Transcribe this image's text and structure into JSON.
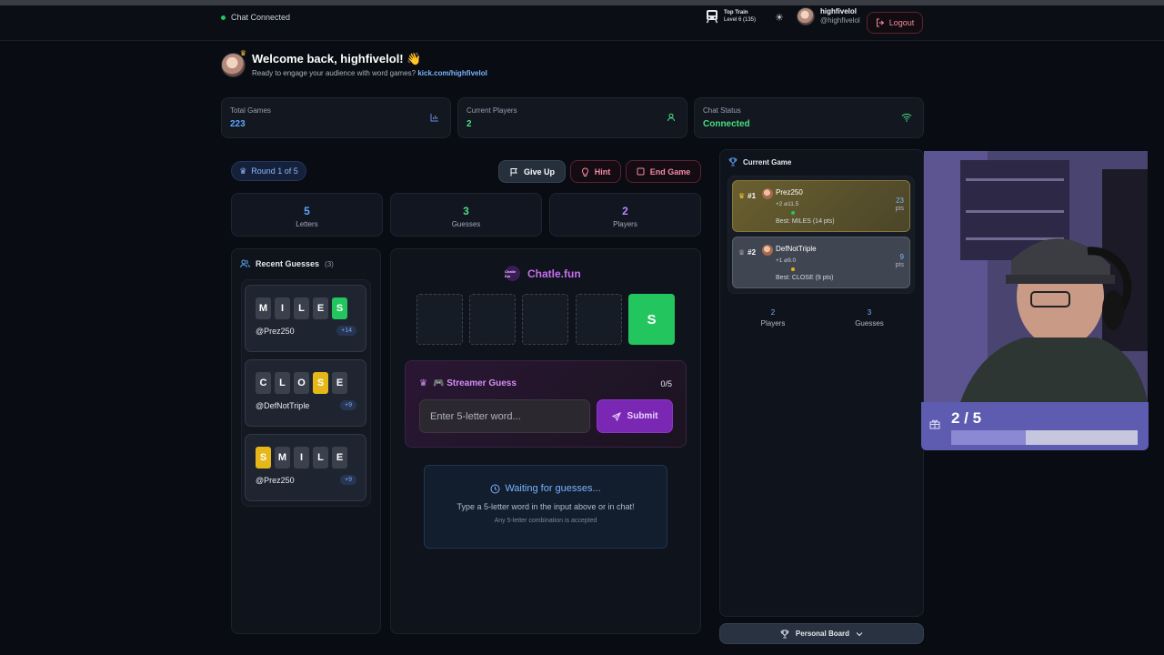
{
  "navbar": {
    "chat_status": "Chat Connected",
    "train_line1": "Top Train",
    "train_line2": "Level 6  (135)",
    "username": "highfivelol",
    "handle": "@highfivelol",
    "logout_label": "Logout"
  },
  "welcome": {
    "title": "Welcome back, highfivelol! 👋",
    "subtitle": "Ready to engage your audience with word games?",
    "link": "kick.com/highfivelol"
  },
  "stats": [
    {
      "label": "Total Games",
      "value": "223",
      "color": "#60a5fa"
    },
    {
      "label": "Current Players",
      "value": "2",
      "color": "#4ade80"
    },
    {
      "label": "Chat Status",
      "value": "Connected",
      "color": "#4ade80"
    }
  ],
  "game": {
    "round_label": "Round 1 of 5",
    "give_up_label": "Give Up",
    "hint_label": "Hint",
    "end_game_label": "End Game",
    "mini_stats": [
      {
        "value": "5",
        "label": "Letters",
        "color": "#60a5fa"
      },
      {
        "value": "3",
        "label": "Guesses",
        "color": "#4ade80"
      },
      {
        "value": "2",
        "label": "Players",
        "color": "#c084fc"
      }
    ]
  },
  "recent": {
    "title": "Recent Guesses",
    "count": "(3)",
    "guesses": [
      {
        "letters": [
          "M",
          "I",
          "L",
          "E",
          "S"
        ],
        "states": [
          "n",
          "n",
          "n",
          "n",
          "g"
        ],
        "user": "@Prez250",
        "points": "+14"
      },
      {
        "letters": [
          "C",
          "L",
          "O",
          "S",
          "E"
        ],
        "states": [
          "n",
          "n",
          "n",
          "y",
          "n"
        ],
        "user": "@DefNotTriple",
        "points": "+9"
      },
      {
        "letters": [
          "S",
          "M",
          "I",
          "L",
          "E"
        ],
        "states": [
          "y",
          "n",
          "n",
          "n",
          "n"
        ],
        "user": "@Prez250",
        "points": "+9"
      }
    ]
  },
  "board": {
    "brand_logo_text": "Chatle fun",
    "brand_name": "Chatle.fun",
    "slots": [
      "",
      "",
      "",
      "",
      "S"
    ]
  },
  "streamer": {
    "title": "🎮 Streamer Guess",
    "count": "0/5",
    "placeholder": "Enter 5-letter word...",
    "submit_label": "Submit"
  },
  "waiting": {
    "title": "Waiting for guesses...",
    "line1": "Type a 5-letter word in the input above or in chat!",
    "line2": "Any 5-letter combination is accepted"
  },
  "current_game": {
    "title": "Current Game",
    "players": [
      {
        "rank": "#1",
        "name": "Prez250",
        "sub": "+2  ⌀11.5",
        "best": "Best: MILES (14 pts)",
        "score": "23",
        "unit": "pts",
        "dot": "#22c55e"
      },
      {
        "rank": "#2",
        "name": "DefNotTriple",
        "sub": "+1  ⌀9.0",
        "best": "Best: CLOSE (9 pts)",
        "score": "9",
        "unit": "pts",
        "dot": "#eab308"
      }
    ],
    "players_count": "2",
    "players_label": "Players",
    "guesses_count": "3",
    "guesses_label": "Guesses"
  },
  "personal_board_label": "Personal Board",
  "overlay": {
    "progress_text": "2 / 5",
    "progress_fraction": 0.4
  }
}
